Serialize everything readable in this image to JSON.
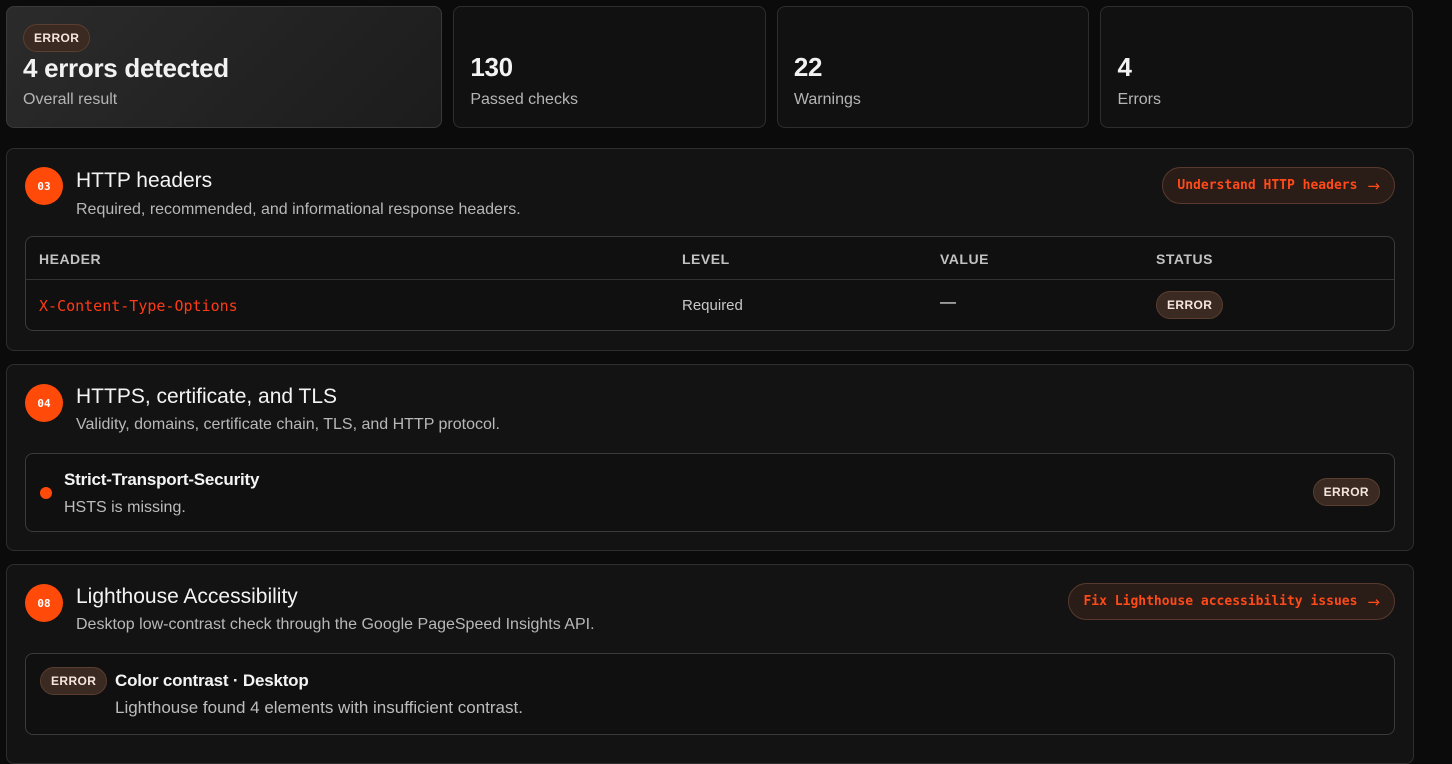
{
  "summary": {
    "overall": {
      "badge": "ERROR",
      "headline": "4 errors detected",
      "label": "Overall result"
    },
    "stats": [
      {
        "value": "130",
        "label": "Passed checks"
      },
      {
        "value": "22",
        "label": "Warnings"
      },
      {
        "value": "4",
        "label": "Errors"
      }
    ]
  },
  "sections": {
    "http_headers": {
      "number": "03",
      "title": "HTTP headers",
      "description": "Required, recommended, and informational response headers.",
      "action_label": "Understand HTTP headers",
      "table": {
        "columns": [
          "HEADER",
          "LEVEL",
          "VALUE",
          "STATUS"
        ],
        "rows": [
          {
            "header": "X-Content-Type-Options",
            "level": "Required",
            "value": "—",
            "status": "ERROR"
          }
        ]
      }
    },
    "https": {
      "number": "04",
      "title": "HTTPS, certificate, and TLS",
      "description": "Validity, domains, certificate chain, TLS, and HTTP protocol.",
      "items": [
        {
          "title": "Strict-Transport-Security",
          "description": "HSTS is missing.",
          "status": "ERROR"
        }
      ]
    },
    "lighthouse": {
      "number": "08",
      "title": "Lighthouse Accessibility",
      "description": "Desktop low-contrast check through the Google PageSpeed Insights API.",
      "action_label": "Fix Lighthouse accessibility issues",
      "items": [
        {
          "status": "ERROR",
          "title": "Color contrast · Desktop",
          "description": "Lighthouse found 4 elements with insufficient contrast."
        }
      ]
    }
  },
  "colors": {
    "accent": "#ff4a0a",
    "background": "#0b0b0b",
    "card": "#131313"
  },
  "icons": {
    "action_arrow": "arrow-right-icon",
    "status_dot": "status-dot-icon"
  }
}
